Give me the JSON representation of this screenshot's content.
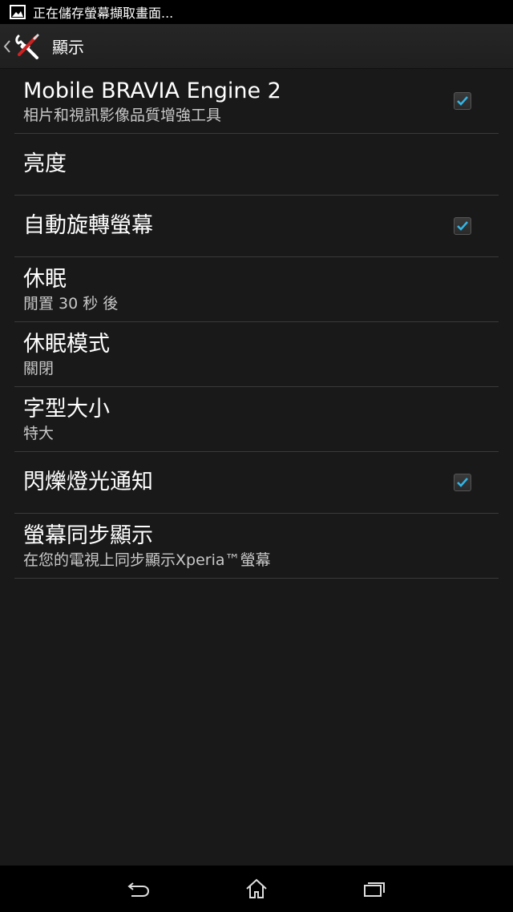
{
  "status_bar": {
    "text": "正在儲存螢幕擷取畫面...",
    "icon": "image-icon"
  },
  "action_bar": {
    "title": "顯示",
    "back_icon": "chevron-left-icon",
    "app_icon": "tools-icon"
  },
  "settings": [
    {
      "title": "Mobile BRAVIA Engine 2",
      "summary": "相片和視訊影像品質增強工具",
      "checkbox": true,
      "checked": true
    },
    {
      "title": "亮度",
      "summary": "",
      "checkbox": false
    },
    {
      "title": "自動旋轉螢幕",
      "summary": "",
      "checkbox": true,
      "checked": true
    },
    {
      "title": "休眠",
      "summary": "閒置 30 秒 後",
      "checkbox": false
    },
    {
      "title": "休眠模式",
      "summary": "關閉",
      "checkbox": false
    },
    {
      "title": "字型大小",
      "summary": "特大",
      "checkbox": false
    },
    {
      "title": "閃爍燈光通知",
      "summary": "",
      "checkbox": true,
      "checked": true
    },
    {
      "title": "螢幕同步顯示",
      "summary": "在您的電視上同步顯示Xperia™螢幕",
      "checkbox": false
    }
  ],
  "nav_bar": {
    "back_icon": "back-arrow-icon",
    "home_icon": "home-icon",
    "recents_icon": "recent-apps-icon"
  },
  "colors": {
    "background": "#191919",
    "checkmark": "#33b5e5"
  }
}
